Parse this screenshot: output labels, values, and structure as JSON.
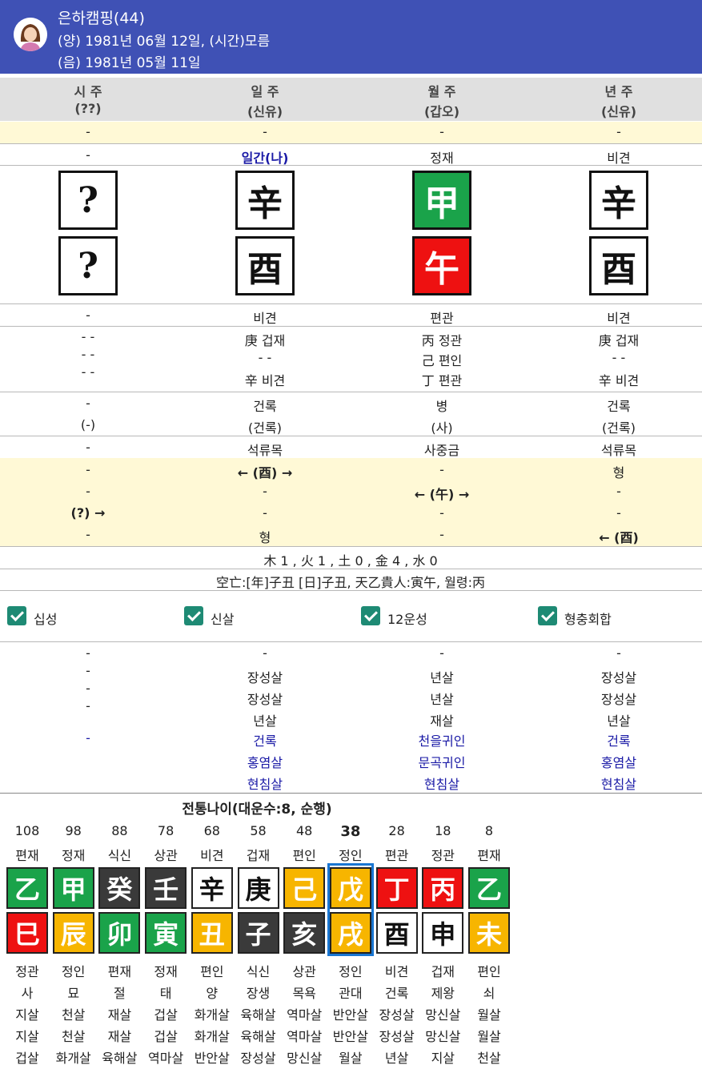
{
  "header": {
    "name": "은하캠핑(44)",
    "solar": "(양) 1981년 06월 12일, (시간)모름",
    "lunar": "(음) 1981년 05월 11일"
  },
  "colors": {
    "header_bg": "#3f51b5",
    "yellow_band": "#fff9d6",
    "accent_blue": "#1a1aa6",
    "green": "#1aa34a",
    "red": "#ee1111",
    "white": "#ffffff",
    "black": "#3a3a3a",
    "yellow": "#f7b500",
    "checkbox": "#1e8a74",
    "selection": "#1976d2"
  },
  "pillar_headers": [
    {
      "title": "시 주",
      "sub": "(??)"
    },
    {
      "title": "일 주",
      "sub": "(신유)"
    },
    {
      "title": "월 주",
      "sub": "(갑오)"
    },
    {
      "title": "년 주",
      "sub": "(신유)"
    }
  ],
  "row_top_dash": [
    "-",
    "-",
    "-",
    "-"
  ],
  "row_stem_ten_god": [
    "-",
    "일간(나)",
    "정재",
    "비견"
  ],
  "stems": [
    {
      "char": "?",
      "color": "white"
    },
    {
      "char": "辛",
      "color": "white"
    },
    {
      "char": "甲",
      "color": "green"
    },
    {
      "char": "辛",
      "color": "white"
    }
  ],
  "branches": [
    {
      "char": "?",
      "color": "white"
    },
    {
      "char": "酉",
      "color": "white"
    },
    {
      "char": "午",
      "color": "red"
    },
    {
      "char": "酉",
      "color": "white"
    }
  ],
  "row_branch_ten_god": [
    "-",
    "비견",
    "편관",
    "비견"
  ],
  "hidden_stems": [
    [
      "- -",
      "- -",
      "- -"
    ],
    [
      "庚 겁재",
      "- -",
      "辛 비견"
    ],
    [
      "丙 정관",
      "己 편인",
      "丁 편관"
    ],
    [
      "庚 겁재",
      "- -",
      "辛 비견"
    ]
  ],
  "twelve_stage": [
    [
      "-",
      "(-)"
    ],
    [
      "건록",
      "(건록)"
    ],
    [
      "병",
      "(사)"
    ],
    [
      "건록",
      "(건록)"
    ]
  ],
  "napeum": [
    "-",
    "석류목",
    "사중금",
    "석류목"
  ],
  "relations": [
    [
      "-",
      "-",
      "(?) →",
      "-"
    ],
    [
      "← (酉) →",
      "-",
      "-",
      "형"
    ],
    [
      "-",
      "← (午) →",
      "-",
      "-"
    ],
    [
      "형",
      "-",
      "-",
      "← (酉)"
    ]
  ],
  "elements_summary": "木 1 , 火 1 , 土 0 , 金 4 , 水 0",
  "gongmang_summary": "空亡:[年]子丑 [日]子丑, 天乙貴人:寅午, 월령:丙",
  "checkboxes": [
    {
      "label": "십성",
      "checked": true
    },
    {
      "label": "신살",
      "checked": true
    },
    {
      "label": "12운성",
      "checked": true
    },
    {
      "label": "형충회합",
      "checked": true
    }
  ],
  "sinsal": [
    {
      "black": [
        "-",
        "-",
        "-",
        "-"
      ],
      "blue": [
        "-"
      ]
    },
    {
      "black": [
        "-",
        "장성살",
        "장성살",
        "년살"
      ],
      "blue": [
        "건록",
        "홍염살",
        "현침살"
      ]
    },
    {
      "black": [
        "-",
        "년살",
        "년살",
        "재살"
      ],
      "blue": [
        "천을귀인",
        "문곡귀인",
        "현침살"
      ]
    },
    {
      "black": [
        "-",
        "장성살",
        "장성살",
        "년살"
      ],
      "blue": [
        "건록",
        "홍염살",
        "현침살"
      ]
    }
  ],
  "daeun": {
    "title": "전통나이(대운수:8, 순행)",
    "selected_index": 7,
    "columns": [
      {
        "age": "108",
        "top": "편재",
        "stem": "乙",
        "stem_color": "green",
        "branch": "巳",
        "branch_color": "red",
        "bottom": [
          "정관",
          "사",
          "지살",
          "지살",
          "겁살"
        ]
      },
      {
        "age": "98",
        "top": "정재",
        "stem": "甲",
        "stem_color": "green",
        "branch": "辰",
        "branch_color": "yellow",
        "bottom": [
          "정인",
          "묘",
          "천살",
          "천살",
          "화개살"
        ]
      },
      {
        "age": "88",
        "top": "식신",
        "stem": "癸",
        "stem_color": "black",
        "branch": "卯",
        "branch_color": "green",
        "bottom": [
          "편재",
          "절",
          "재살",
          "재살",
          "육해살"
        ]
      },
      {
        "age": "78",
        "top": "상관",
        "stem": "壬",
        "stem_color": "black",
        "branch": "寅",
        "branch_color": "green",
        "bottom": [
          "정재",
          "태",
          "겁살",
          "겁살",
          "역마살"
        ]
      },
      {
        "age": "68",
        "top": "비견",
        "stem": "辛",
        "stem_color": "white",
        "branch": "丑",
        "branch_color": "yellow",
        "bottom": [
          "편인",
          "양",
          "화개살",
          "화개살",
          "반안살"
        ]
      },
      {
        "age": "58",
        "top": "겁재",
        "stem": "庚",
        "stem_color": "white",
        "branch": "子",
        "branch_color": "black",
        "bottom": [
          "식신",
          "장생",
          "육해살",
          "육해살",
          "장성살"
        ]
      },
      {
        "age": "48",
        "top": "편인",
        "stem": "己",
        "stem_color": "yellow",
        "branch": "亥",
        "branch_color": "black",
        "bottom": [
          "상관",
          "목욕",
          "역마살",
          "역마살",
          "망신살"
        ]
      },
      {
        "age": "38",
        "top": "정인",
        "stem": "戊",
        "stem_color": "yellow",
        "branch": "戌",
        "branch_color": "yellow",
        "bottom": [
          "정인",
          "관대",
          "반안살",
          "반안살",
          "월살"
        ]
      },
      {
        "age": "28",
        "top": "편관",
        "stem": "丁",
        "stem_color": "red",
        "branch": "酉",
        "branch_color": "white",
        "bottom": [
          "비견",
          "건록",
          "장성살",
          "장성살",
          "년살"
        ]
      },
      {
        "age": "18",
        "top": "정관",
        "stem": "丙",
        "stem_color": "red",
        "branch": "申",
        "branch_color": "white",
        "bottom": [
          "겁재",
          "제왕",
          "망신살",
          "망신살",
          "지살"
        ]
      },
      {
        "age": "8",
        "top": "편재",
        "stem": "乙",
        "stem_color": "green",
        "branch": "未",
        "branch_color": "yellow",
        "bottom": [
          "편인",
          "쇠",
          "월살",
          "월살",
          "천살"
        ]
      }
    ]
  }
}
